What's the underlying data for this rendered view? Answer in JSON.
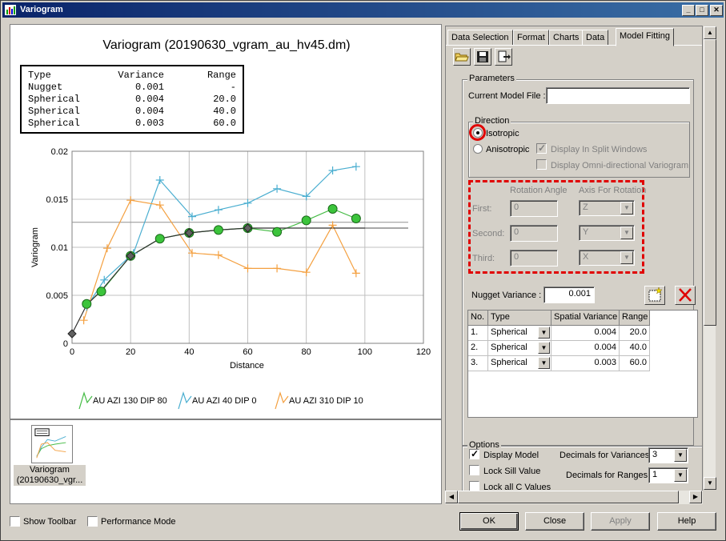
{
  "window": {
    "title": "Variogram"
  },
  "chart": {
    "title": "Variogram (20190630_vgram_au_hv45.dm)",
    "table_headers": [
      "Type",
      "Variance",
      "Range"
    ],
    "table_rows": [
      [
        "Nugget",
        "0.001",
        "-"
      ],
      [
        "Spherical",
        "0.004",
        "20.0"
      ],
      [
        "Spherical",
        "0.004",
        "40.0"
      ],
      [
        "Spherical",
        "0.003",
        "60.0"
      ]
    ]
  },
  "chart_data": {
    "type": "line",
    "xlabel": "Distance",
    "ylabel": "Variogram",
    "xlim": [
      0,
      120
    ],
    "ylim": [
      0,
      0.02
    ],
    "x_ticks": [
      "0",
      "20",
      "40",
      "60",
      "80",
      "100",
      "120"
    ],
    "y_ticks": [
      "0",
      "0.005",
      "0.01",
      "0.015",
      "0.02"
    ],
    "grid": true,
    "legend_position": "bottom",
    "series": [
      {
        "name": "AU AZI 130 DIP 80",
        "color": "#44bb44",
        "x": [
          5,
          10,
          20,
          30,
          40,
          50,
          60,
          70,
          80,
          89,
          97
        ],
        "y": [
          0.0041,
          0.0054,
          0.0091,
          0.0109,
          0.0115,
          0.0118,
          0.012,
          0.0116,
          0.0128,
          0.014,
          0.013
        ]
      },
      {
        "name": "AU AZI 40 DIP 0",
        "color": "#4aaed0",
        "x": [
          5,
          11,
          21,
          30,
          41,
          50,
          60,
          70,
          80,
          89,
          97
        ],
        "y": [
          0.0038,
          0.0066,
          0.0094,
          0.017,
          0.0132,
          0.0139,
          0.0146,
          0.0161,
          0.0153,
          0.018,
          0.0184
        ]
      },
      {
        "name": "AU AZI 310 DIP 10",
        "color": "#f4a040",
        "x": [
          4,
          12,
          20,
          30,
          41,
          50,
          60,
          70,
          80,
          89,
          97
        ],
        "y": [
          0.0024,
          0.0099,
          0.0149,
          0.0144,
          0.0094,
          0.0092,
          0.0078,
          0.0078,
          0.0074,
          0.0123,
          0.0073
        ]
      }
    ],
    "model_x": [
      0,
      5,
      10,
      20,
      30,
      40,
      50,
      60,
      70,
      80,
      90,
      100
    ],
    "model_y": [
      0.001,
      0.004,
      0.0055,
      0.0091,
      0.0109,
      0.0115,
      0.0118,
      0.012,
      0.012,
      0.012,
      0.012,
      0.012
    ],
    "sill_total": 0.0126,
    "sill_partial": 0.012
  },
  "thumbnail": {
    "caption": "Variogram (20190630_vgr..."
  },
  "bottom": {
    "show_toolbar": "Show Toolbar",
    "performance_mode": "Performance Mode",
    "ok": "OK",
    "close": "Close",
    "apply": "Apply",
    "help": "Help"
  },
  "tabs": [
    "Data Selection",
    "Format",
    "Charts",
    "Data",
    "Model Fitting"
  ],
  "parameters": {
    "group_title": "Parameters",
    "current_model_file_label": "Current Model File :",
    "current_model_file_value": "",
    "direction_title": "Direction",
    "isotropic": "Isotropic",
    "anisotropic": "Anisotropic",
    "display_split": "Display In Split Windows",
    "display_omni": "Display Omni-directional Variogram",
    "rotation_angle": "Rotation Angle",
    "axis_for_rotation": "Axis For Rotation",
    "rows": [
      {
        "label": "First:",
        "angle": "0",
        "axis": "Z"
      },
      {
        "label": "Second:",
        "angle": "0",
        "axis": "Y"
      },
      {
        "label": "Third:",
        "angle": "0",
        "axis": "X"
      }
    ],
    "nugget_label": "Nugget Variance :",
    "nugget_value": "0.001"
  },
  "structures": {
    "headers": [
      "No.",
      "Type",
      "Spatial Variance",
      "Range"
    ],
    "rows": [
      [
        "1.",
        "Spherical",
        "0.004",
        "20.0"
      ],
      [
        "2.",
        "Spherical",
        "0.004",
        "40.0"
      ],
      [
        "3.",
        "Spherical",
        "0.003",
        "60.0"
      ]
    ]
  },
  "options": {
    "group_title": "Options",
    "display_model": "Display Model",
    "lock_sill": "Lock Sill Value",
    "lock_all_c": "Lock all C Values",
    "decimals_variances_label": "Decimals for Variances",
    "decimals_variances_value": "3",
    "decimals_ranges_label": "Decimals for Ranges",
    "decimals_ranges_value": "1"
  }
}
